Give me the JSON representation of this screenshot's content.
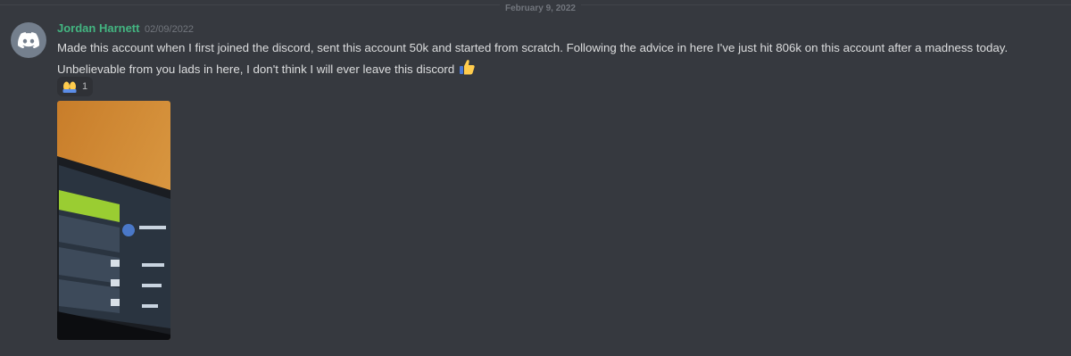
{
  "divider": {
    "date": "February 9, 2022"
  },
  "message": {
    "author": "Jordan Harnett",
    "timestamp": "02/09/2022",
    "line1": "Made this account when I first joined the discord, sent this account 50k and started from scratch. Following the advice in here I've just hit 806k on this account after a madness today.",
    "line2": "Unbelievable from you lads in here, I don't think I will ever leave this discord",
    "author_color": "#43b581"
  },
  "reaction": {
    "emoji_icon": "raised-hands-emoji",
    "count": "1"
  },
  "avatar": {
    "icon": "discord-logo-icon",
    "color": "#747f8d"
  }
}
